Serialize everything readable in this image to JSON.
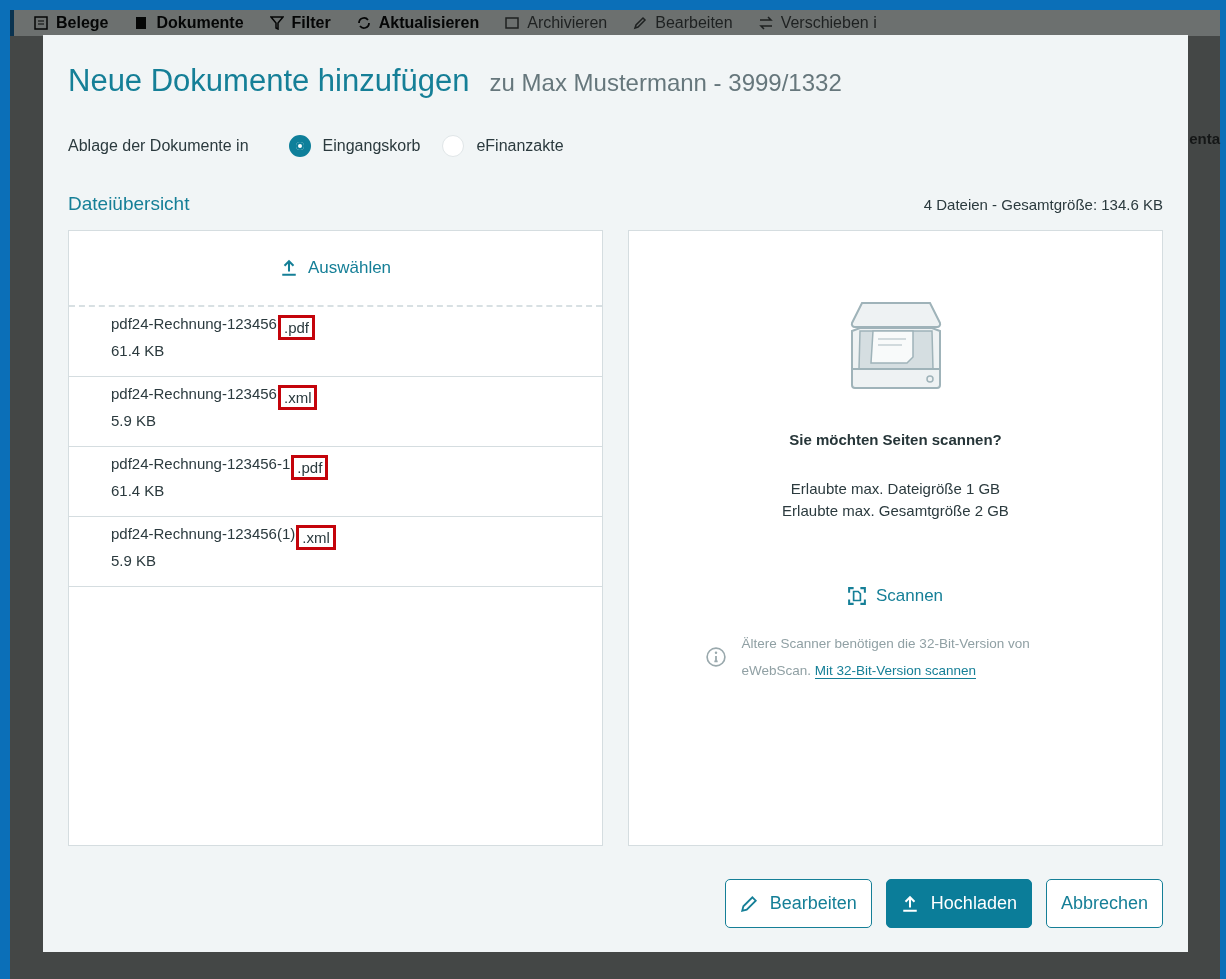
{
  "background": {
    "toolbar": [
      {
        "label": "Belege",
        "kind": "list",
        "disabled": false
      },
      {
        "label": "Dokumente",
        "kind": "doc",
        "disabled": false
      },
      {
        "label": "Filter",
        "kind": "filter",
        "disabled": false
      },
      {
        "label": "Aktualisieren",
        "kind": "refresh",
        "disabled": false
      },
      {
        "label": "Archivieren",
        "kind": "archive",
        "disabled": true
      },
      {
        "label": "Bearbeiten",
        "kind": "edit",
        "disabled": true
      },
      {
        "label": "Verschieben i",
        "kind": "move",
        "disabled": true
      }
    ],
    "column_fragment": "enta"
  },
  "dialog": {
    "title": "Neue Dokumente hinzufügen",
    "subtitle": "zu Max Mustermann - 3999/1332",
    "storage": {
      "label": "Ablage der Dokumente in",
      "options": [
        {
          "label": "Eingangskorb",
          "selected": true
        },
        {
          "label": "eFinanzakte",
          "selected": false
        }
      ]
    },
    "section_title": "Dateiübersicht",
    "summary": "4 Dateien - Gesamtgröße: 134.6 KB",
    "select_button": "Auswählen",
    "files": [
      {
        "name": "pdf24-Rechnung-123456",
        "extension": ".pdf",
        "size": "61.4 KB",
        "highlighted": true
      },
      {
        "name": "pdf24-Rechnung-123456",
        "extension": ".xml",
        "size": "5.9 KB",
        "highlighted": true
      },
      {
        "name": "pdf24-Rechnung-123456-1",
        "extension": ".pdf",
        "size": "61.4 KB",
        "highlighted": true
      },
      {
        "name": "pdf24-Rechnung-123456(1)",
        "extension": ".xml",
        "size": "5.9 KB",
        "highlighted": true
      }
    ],
    "scan": {
      "heading": "Sie möchten Seiten scannen?",
      "limits": [
        "Erlaubte max. Dateigröße 1 GB",
        "Erlaubte max. Gesamtgröße 2 GB"
      ],
      "button": "Scannen",
      "note": "Ältere Scanner benötigen die 32-Bit-Version von eWebScan.",
      "note_link": "Mit 32-Bit-Version scannen"
    },
    "buttons": [
      {
        "label": "Bearbeiten",
        "kind": "edit"
      },
      {
        "label": "Hochladen",
        "kind": "upload"
      },
      {
        "label": "Abbrechen",
        "kind": "plain"
      }
    ]
  }
}
